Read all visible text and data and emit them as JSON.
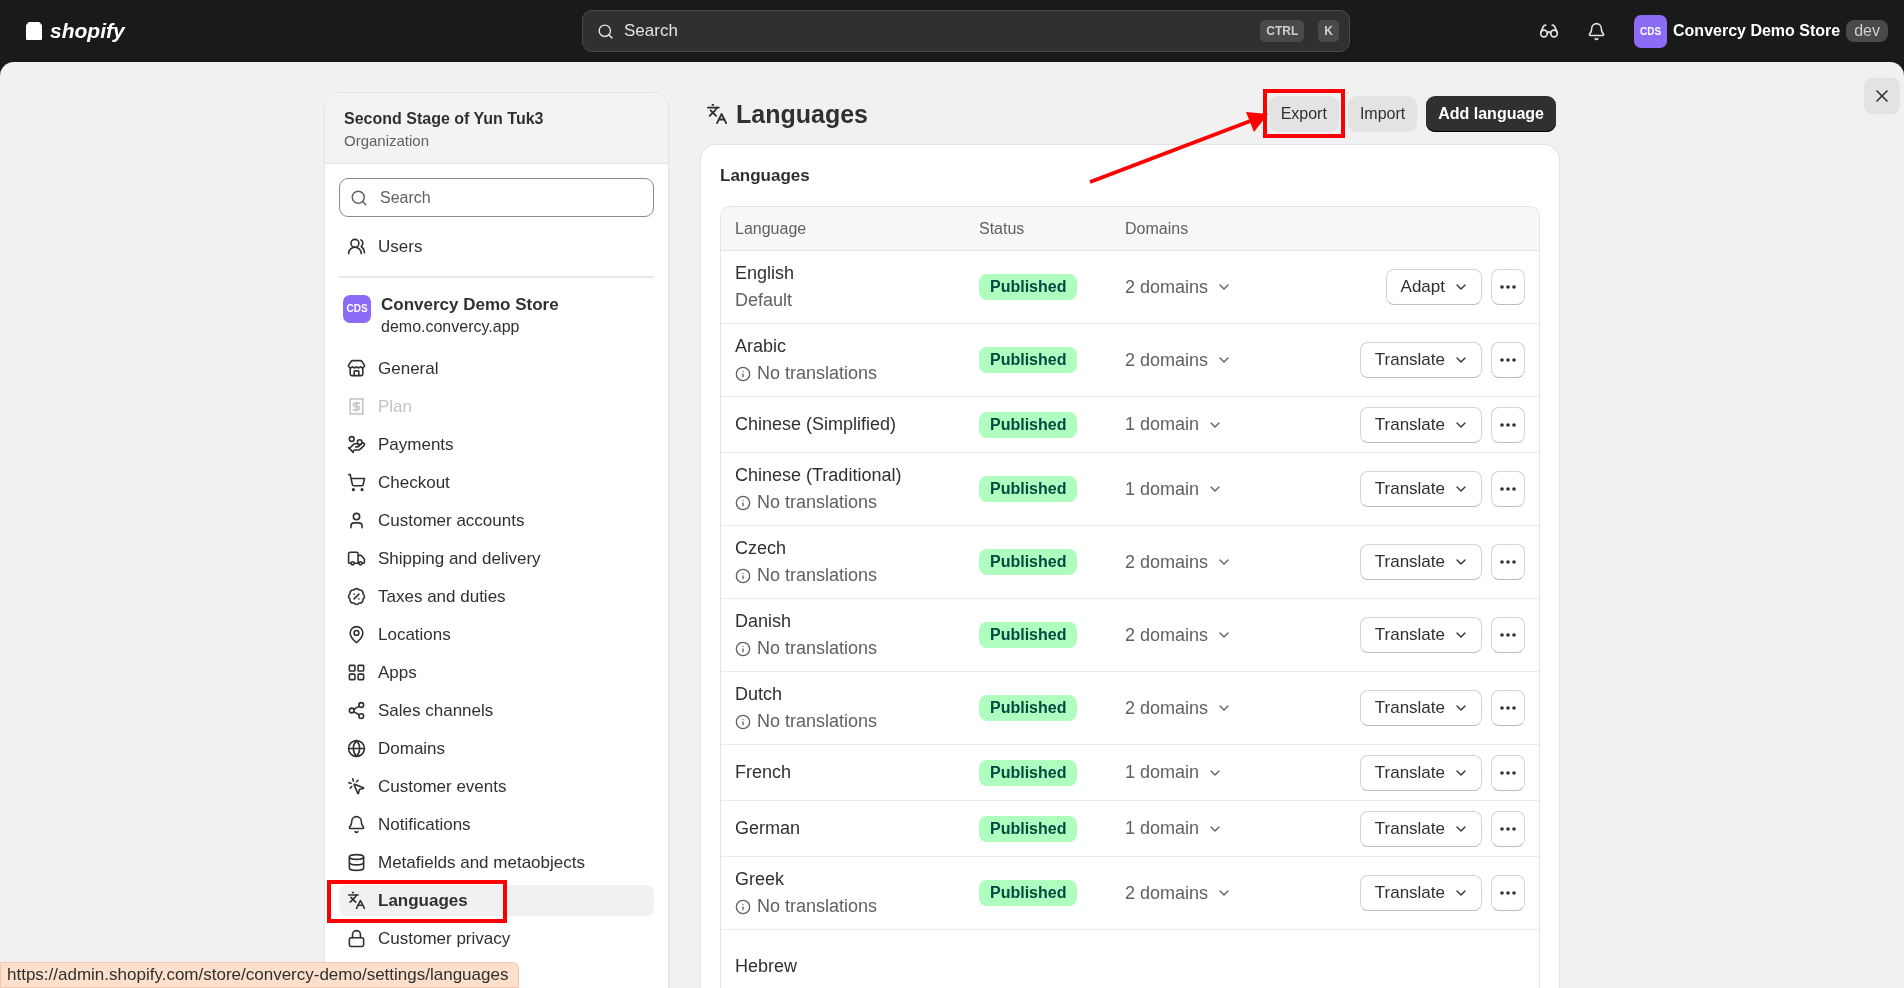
{
  "topbar": {
    "logo": "shopify",
    "search": {
      "placeholder": "Search"
    },
    "shortcut": [
      "CTRL",
      "K"
    ],
    "store": {
      "avatar": "CDS",
      "name": "Convercy Demo Store",
      "badge": "dev"
    }
  },
  "sidebar": {
    "org": {
      "name": "Second Stage of Yun Tuk3",
      "subtitle": "Organization"
    },
    "search": {
      "placeholder": "Search"
    },
    "users": "Users",
    "store": {
      "avatar": "CDS",
      "name": "Convercy Demo Store",
      "domain": "demo.convercy.app"
    },
    "items": [
      {
        "label": "General",
        "selected": false,
        "disabled": false
      },
      {
        "label": "Plan",
        "selected": false,
        "disabled": true
      },
      {
        "label": "Payments",
        "selected": false,
        "disabled": false
      },
      {
        "label": "Checkout",
        "selected": false,
        "disabled": false
      },
      {
        "label": "Customer accounts",
        "selected": false,
        "disabled": false
      },
      {
        "label": "Shipping and delivery",
        "selected": false,
        "disabled": false
      },
      {
        "label": "Taxes and duties",
        "selected": false,
        "disabled": false
      },
      {
        "label": "Locations",
        "selected": false,
        "disabled": false
      },
      {
        "label": "Apps",
        "selected": false,
        "disabled": false
      },
      {
        "label": "Sales channels",
        "selected": false,
        "disabled": false
      },
      {
        "label": "Domains",
        "selected": false,
        "disabled": false
      },
      {
        "label": "Customer events",
        "selected": false,
        "disabled": false
      },
      {
        "label": "Notifications",
        "selected": false,
        "disabled": false
      },
      {
        "label": "Metafields and metaobjects",
        "selected": false,
        "disabled": false
      },
      {
        "label": "Languages",
        "selected": true,
        "disabled": false
      },
      {
        "label": "Customer privacy",
        "selected": false,
        "disabled": false
      }
    ]
  },
  "page": {
    "title": "Languages",
    "buttons": [
      {
        "label": "Export",
        "kind": "secondary"
      },
      {
        "label": "Import",
        "kind": "secondary"
      },
      {
        "label": "Add language",
        "kind": "primary"
      }
    ],
    "card": {
      "title": "Languages",
      "columns": [
        "Language",
        "Status",
        "Domains"
      ],
      "rows": [
        {
          "name": "English",
          "note": {
            "text": "Default",
            "kind": "plain"
          },
          "status": "Published",
          "domains": "2 domains",
          "action": "Adapt"
        },
        {
          "name": "Arabic",
          "note": {
            "text": "No translations",
            "kind": "info"
          },
          "status": "Published",
          "domains": "2 domains",
          "action": "Translate"
        },
        {
          "name": "Chinese (Simplified)",
          "status": "Published",
          "domains": "1 domain",
          "action": "Translate"
        },
        {
          "name": "Chinese (Traditional)",
          "note": {
            "text": "No translations",
            "kind": "info"
          },
          "status": "Published",
          "domains": "1 domain",
          "action": "Translate"
        },
        {
          "name": "Czech",
          "note": {
            "text": "No translations",
            "kind": "info"
          },
          "status": "Published",
          "domains": "2 domains",
          "action": "Translate"
        },
        {
          "name": "Danish",
          "note": {
            "text": "No translations",
            "kind": "info"
          },
          "status": "Published",
          "domains": "2 domains",
          "action": "Translate"
        },
        {
          "name": "Dutch",
          "note": {
            "text": "No translations",
            "kind": "info"
          },
          "status": "Published",
          "domains": "2 domains",
          "action": "Translate"
        },
        {
          "name": "French",
          "status": "Published",
          "domains": "1 domain",
          "action": "Translate"
        },
        {
          "name": "German",
          "status": "Published",
          "domains": "1 domain",
          "action": "Translate"
        },
        {
          "name": "Greek",
          "note": {
            "text": "No translations",
            "kind": "info"
          },
          "status": "Published",
          "domains": "2 domains",
          "action": "Translate"
        },
        {
          "name": "Hebrew"
        }
      ]
    }
  },
  "status_url": "https://admin.shopify.com/store/convercy-demo/settings/languages"
}
